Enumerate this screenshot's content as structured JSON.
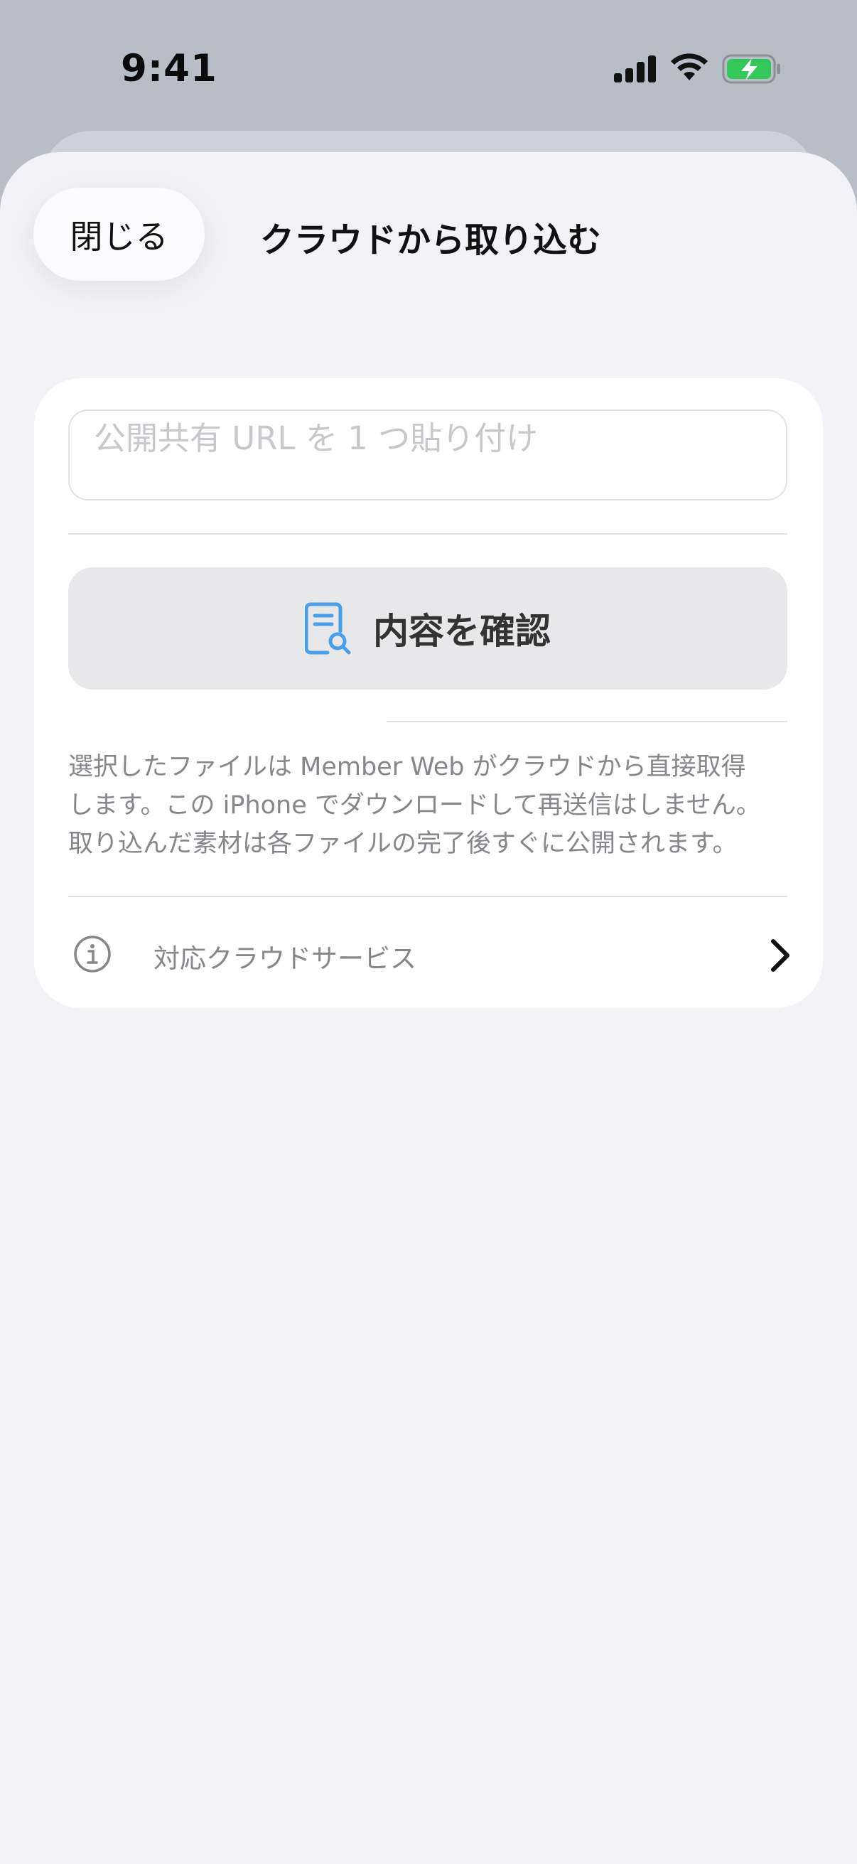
{
  "status_bar": {
    "time": "9:41",
    "battery_state": "charging",
    "accent": "#34c759"
  },
  "header": {
    "close_label": "閉じる",
    "title": "クラウドから取り込む"
  },
  "url_input": {
    "placeholder": "公開共有 URL を 1 つ貼り付け",
    "value": ""
  },
  "confirm_button": {
    "label": "内容を確認",
    "icon": "document-search-icon",
    "icon_color": "#4a9fe8"
  },
  "description": {
    "lines": [
      "選択したファイルは Member Web がクラウドから直接取得",
      "します。この iPhone でダウンロードして再送信はしません。",
      "取り込んだ素材は各ファイルの完了後すぐに公開されます。"
    ]
  },
  "services_row": {
    "label": "対応クラウドサービス",
    "icon": "info-icon",
    "trailing_icon": "chevron-right-icon"
  }
}
